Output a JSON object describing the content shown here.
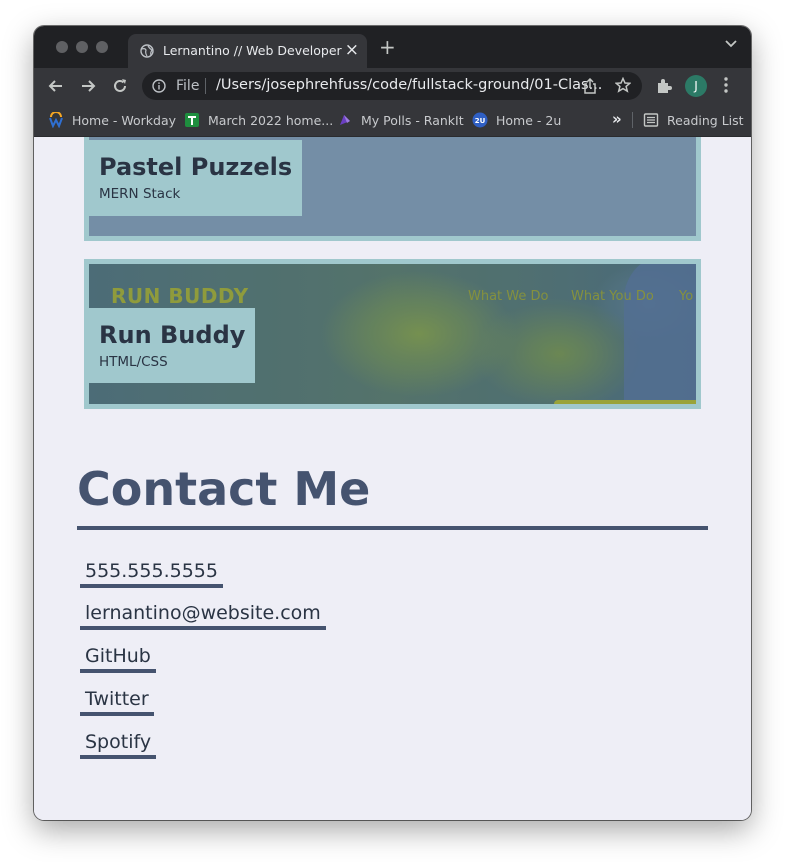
{
  "browser": {
    "tab_title": "Lernantino // Web Developer",
    "address_scheme": "File",
    "address_url": "/Users/josephrehfuss/code/fullstack-ground/01-Clas...",
    "profile_initial": "J",
    "bookmarks": [
      {
        "label": "Home - Workday",
        "icon": "workday-icon"
      },
      {
        "label": "March 2022 home...",
        "icon": "sheets-icon"
      },
      {
        "label": "My Polls - RankIt",
        "icon": "rankit-icon"
      },
      {
        "label": "Home - 2u",
        "icon": "2u-icon"
      }
    ],
    "reading_list": "Reading List"
  },
  "projects": [
    {
      "name": "Pastel Puzzels",
      "stack": "MERN Stack"
    },
    {
      "name": "Run Buddy",
      "stack": "HTML/CSS",
      "preview": {
        "logo": "RUN BUDDY",
        "nav": [
          "What We Do",
          "What You Do",
          "Yo"
        ]
      }
    }
  ],
  "contact": {
    "title": "Contact Me",
    "items": [
      "555.555.5555",
      "lernantino@website.com",
      "GitHub",
      "Twitter",
      "Spotify"
    ]
  },
  "colors": {
    "heading": "#45536f",
    "label_bg": "#a0c8cd",
    "page_bg": "#eeeef6",
    "chrome_dark": "#202124",
    "chrome_toolbar": "#35363a"
  }
}
